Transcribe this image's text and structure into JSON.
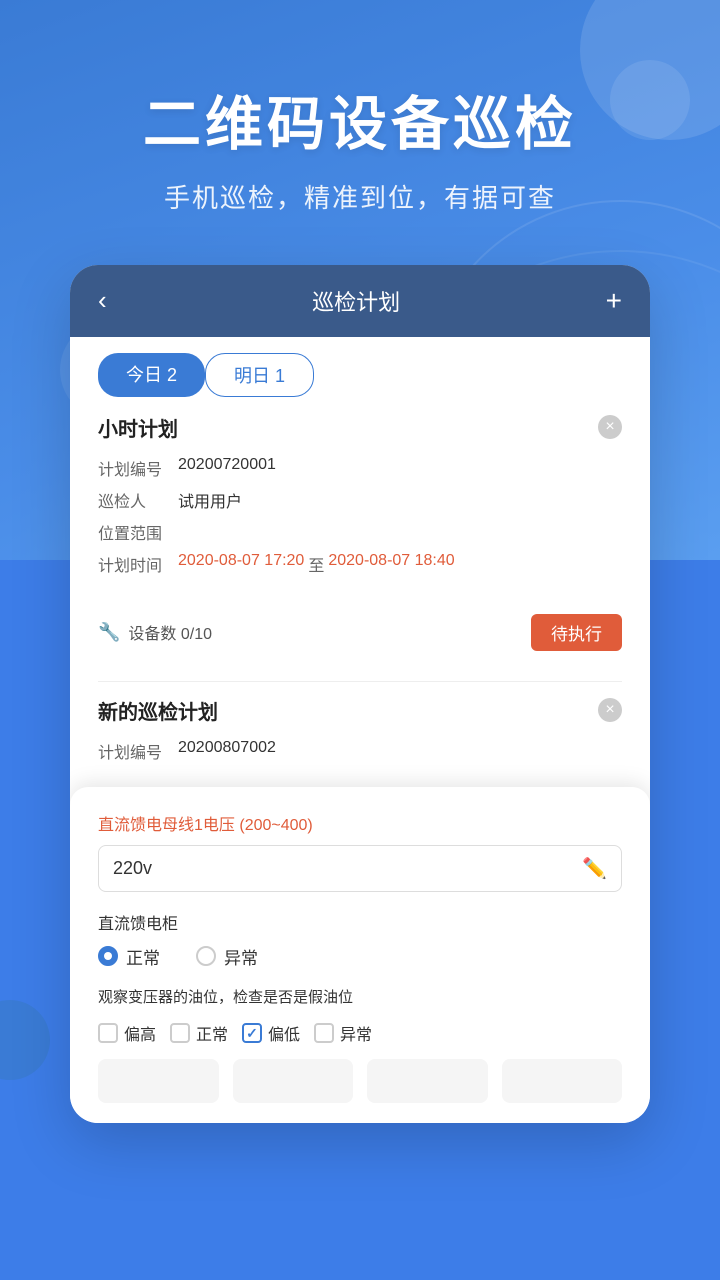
{
  "hero": {
    "title": "二维码设备巡检",
    "subtitle": "手机巡检，精准到位，有据可查"
  },
  "card": {
    "header": {
      "back_icon": "‹",
      "title": "巡检计划",
      "add_icon": "+"
    },
    "tabs": [
      {
        "label": "今日 2",
        "active": true
      },
      {
        "label": "明日 1",
        "active": false
      }
    ],
    "section1": {
      "title": "小时计划",
      "close_icon": "×",
      "fields": [
        {
          "label": "计划编号",
          "value": "20200720001"
        },
        {
          "label": "巡检人",
          "value": "试用用户"
        },
        {
          "label": "位置范围",
          "value": ""
        }
      ],
      "time_label": "计划时间",
      "time_start": "2020-08-07 17:20",
      "time_sep": "至",
      "time_end": "2020-08-07 18:40",
      "device_label": "设备数 0/10",
      "status": "待执行"
    },
    "section2": {
      "title": "新的巡检计划",
      "close_icon": "×",
      "fields": [
        {
          "label": "计划编号",
          "value": "20200807002"
        }
      ]
    },
    "bottom_panel": {
      "field1_label": "直流馈电母线1电压",
      "field1_range": "(200~400)",
      "field1_value": "220v",
      "field2_label": "直流馈电柜",
      "radio_options": [
        {
          "label": "正常",
          "checked": true
        },
        {
          "label": "异常",
          "checked": false
        }
      ],
      "field3_label": "观察变压器的油位，检查是否是假油位",
      "checkbox_options": [
        {
          "label": "偏高",
          "checked": false
        },
        {
          "label": "正常",
          "checked": false
        },
        {
          "label": "偏低",
          "checked": true
        },
        {
          "label": "异常",
          "checked": false
        }
      ]
    }
  }
}
